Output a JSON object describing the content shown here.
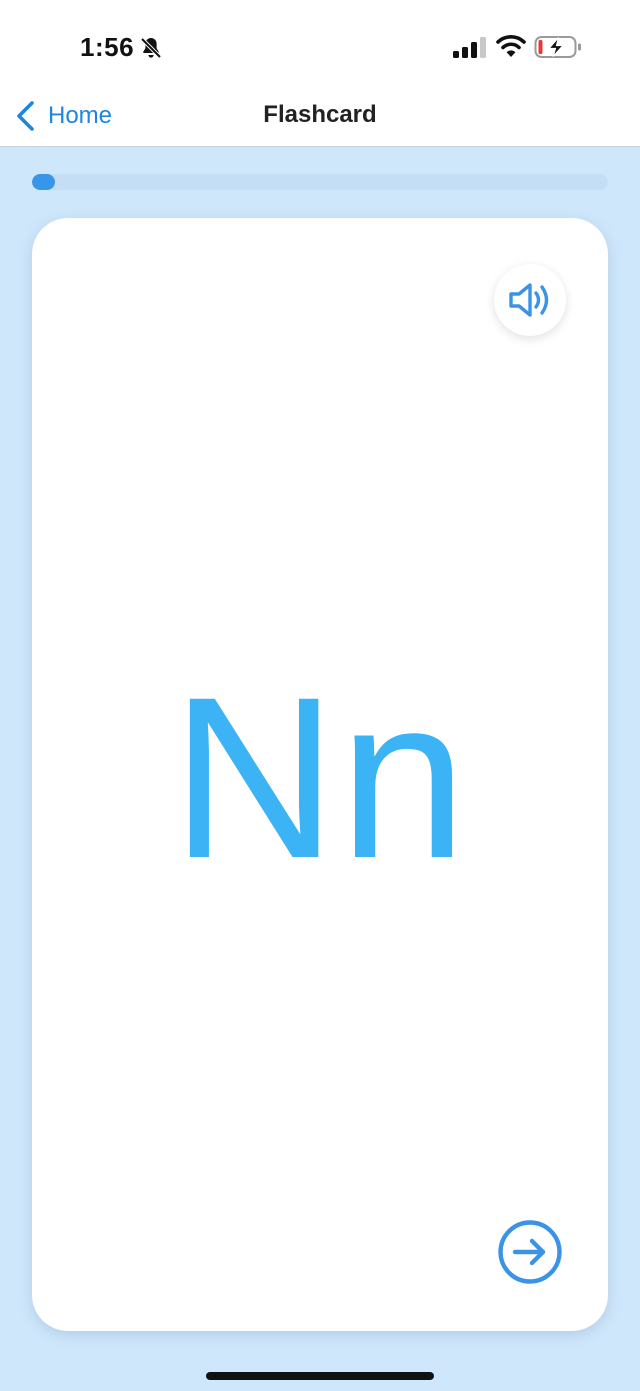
{
  "status_bar": {
    "time": "1:56",
    "icons": [
      "bell-slash-icon",
      "cellular-signal-icon",
      "wifi-icon",
      "battery-charging-icon"
    ]
  },
  "nav": {
    "back_label": "Home",
    "title": "Flashcard",
    "back_icon": "chevron-left-icon"
  },
  "progress": {
    "fraction": 0.04
  },
  "card": {
    "letter": "Nn",
    "speaker_icon": "speaker-icon",
    "next_icon": "arrow-right-circle-icon"
  },
  "colors": {
    "background": "#cfe7fb",
    "accent": "#3896ea",
    "letter": "#3bb3f5",
    "link": "#1e86e0"
  }
}
